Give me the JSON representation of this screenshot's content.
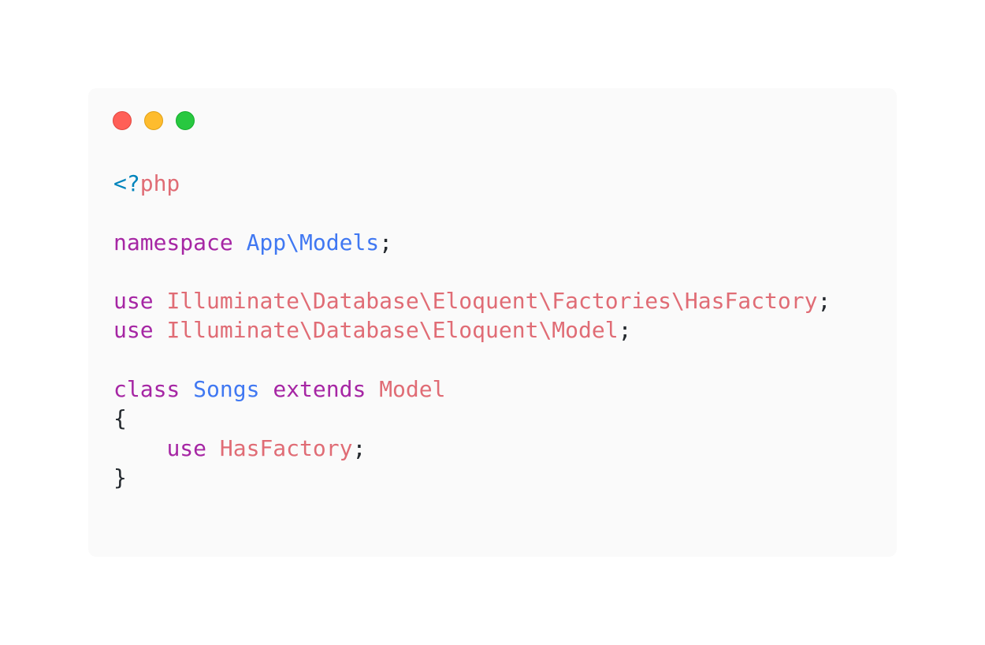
{
  "window": {
    "traffic_lights": [
      {
        "name": "close",
        "color": "#ff5f57"
      },
      {
        "name": "minimize",
        "color": "#febc2e"
      },
      {
        "name": "zoom",
        "color": "#28c840"
      }
    ]
  },
  "code": {
    "language": "php",
    "lines": [
      [
        {
          "t": "tag",
          "v": "<?"
        },
        {
          "t": "type",
          "v": "php"
        }
      ],
      [],
      [
        {
          "t": "kw",
          "v": "namespace"
        },
        {
          "t": "punct",
          "v": " "
        },
        {
          "t": "ns",
          "v": "App\\Models"
        },
        {
          "t": "punct",
          "v": ";"
        }
      ],
      [],
      [
        {
          "t": "kw",
          "v": "use"
        },
        {
          "t": "punct",
          "v": " "
        },
        {
          "t": "type",
          "v": "Illuminate\\Database\\Eloquent\\Factories\\HasFactory"
        },
        {
          "t": "punct",
          "v": ";"
        }
      ],
      [
        {
          "t": "kw",
          "v": "use"
        },
        {
          "t": "punct",
          "v": " "
        },
        {
          "t": "type",
          "v": "Illuminate\\Database\\Eloquent\\Model"
        },
        {
          "t": "punct",
          "v": ";"
        }
      ],
      [],
      [
        {
          "t": "kw",
          "v": "class"
        },
        {
          "t": "punct",
          "v": " "
        },
        {
          "t": "ns",
          "v": "Songs"
        },
        {
          "t": "punct",
          "v": " "
        },
        {
          "t": "kw",
          "v": "extends"
        },
        {
          "t": "punct",
          "v": " "
        },
        {
          "t": "type",
          "v": "Model"
        }
      ],
      [
        {
          "t": "punct",
          "v": "{"
        }
      ],
      [
        {
          "t": "punct",
          "v": "    "
        },
        {
          "t": "kw",
          "v": "use"
        },
        {
          "t": "punct",
          "v": " "
        },
        {
          "t": "type",
          "v": "HasFactory"
        },
        {
          "t": "punct",
          "v": ";"
        }
      ],
      [
        {
          "t": "punct",
          "v": "}"
        }
      ]
    ]
  }
}
